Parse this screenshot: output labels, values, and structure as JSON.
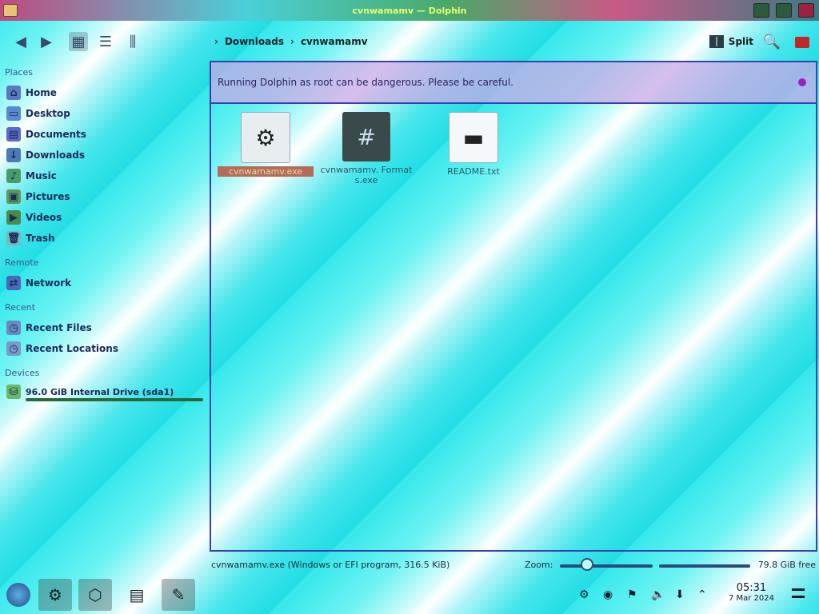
{
  "window": {
    "title": "cvnwamamv — Dolphin"
  },
  "toolbar": {
    "back_icon": "arrow-left-icon",
    "forward_icon": "arrow-right-icon",
    "split_label": "Split",
    "breadcrumb": [
      "Downloads",
      "cvnwamamv"
    ]
  },
  "sidebar": {
    "places_label": "Places",
    "places": [
      {
        "label": "Home",
        "icon": "home-icon"
      },
      {
        "label": "Desktop",
        "icon": "desktop-icon"
      },
      {
        "label": "Documents",
        "icon": "documents-icon"
      },
      {
        "label": "Downloads",
        "icon": "downloads-icon"
      },
      {
        "label": "Music",
        "icon": "music-icon"
      },
      {
        "label": "Pictures",
        "icon": "pictures-icon"
      },
      {
        "label": "Videos",
        "icon": "videos-icon"
      },
      {
        "label": "Trash",
        "icon": "trash-icon"
      }
    ],
    "remote_label": "Remote",
    "remote": [
      {
        "label": "Network",
        "icon": "network-icon"
      }
    ],
    "recent_label": "Recent",
    "recent": [
      {
        "label": "Recent Files",
        "icon": "recent-files-icon"
      },
      {
        "label": "Recent Locations",
        "icon": "recent-locations-icon"
      }
    ],
    "devices_label": "Devices",
    "devices": [
      {
        "label": "96.0 GiB Internal Drive (sda1)",
        "icon": "drive-icon"
      }
    ]
  },
  "banner": {
    "message": "Running Dolphin as root can be dangerous. Please be careful."
  },
  "files": [
    {
      "name": "cvnwamamv.exe",
      "icon": "installer-icon",
      "selected": true
    },
    {
      "name": "cvnwamamv. Formats.exe",
      "icon": "script-icon",
      "selected": false
    },
    {
      "name": "README.txt",
      "icon": "text-file-icon",
      "selected": false
    }
  ],
  "status": {
    "selection": "cvnwamamv.exe (Windows or EFI program, 316.5 KiB)",
    "zoom_label": "Zoom:",
    "free_space": "79.8 GiB free"
  },
  "taskbar": {
    "time": "05:31",
    "date": "7 Mar 2024"
  },
  "colors": {
    "accent": "#3a40b0",
    "banner_bg": "#c8aae6",
    "close": "#c02828"
  }
}
